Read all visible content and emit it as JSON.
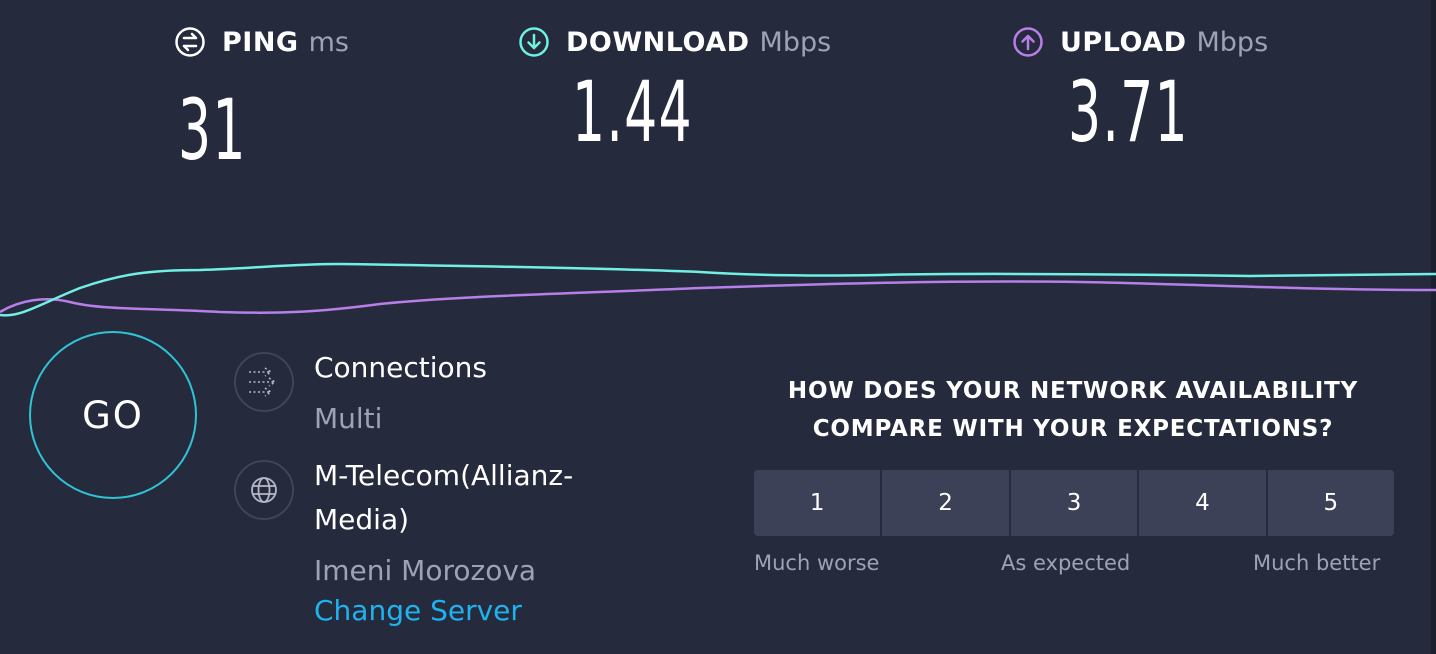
{
  "metrics": {
    "ping": {
      "label": "PING",
      "unit": "ms",
      "value": "31",
      "icon": "ping-icon",
      "color": "#ffffff"
    },
    "download": {
      "label": "DOWNLOAD",
      "unit": "Mbps",
      "value": "1.44",
      "icon": "download-arrow-icon",
      "color": "#6ff0e3"
    },
    "upload": {
      "label": "UPLOAD",
      "unit": "Mbps",
      "value": "3.71",
      "icon": "upload-arrow-icon",
      "color": "#b77fe8"
    }
  },
  "graph": {
    "download_color": "#6ff0e3",
    "upload_color": "#b77fe8"
  },
  "go_button": {
    "label": "GO",
    "accent": "#2ec4d6"
  },
  "connections": {
    "title": "Connections",
    "value": "Multi",
    "icon": "connections-icon"
  },
  "server": {
    "provider": "M-Telecom(Allianz-\nMedia)",
    "provider_line1": "M-Telecom(Allianz-",
    "provider_line2": "Media)",
    "location": "Imeni Morozova",
    "change_label": "Change Server",
    "icon": "globe-icon",
    "link_color": "#1eb3ef"
  },
  "survey": {
    "question_line1": "HOW DOES YOUR NETWORK AVAILABILITY",
    "question_line2": "COMPARE WITH YOUR EXPECTATIONS?",
    "options": [
      "1",
      "2",
      "3",
      "4",
      "5"
    ],
    "label_low": "Much worse",
    "label_mid": "As expected",
    "label_high": "Much better"
  }
}
